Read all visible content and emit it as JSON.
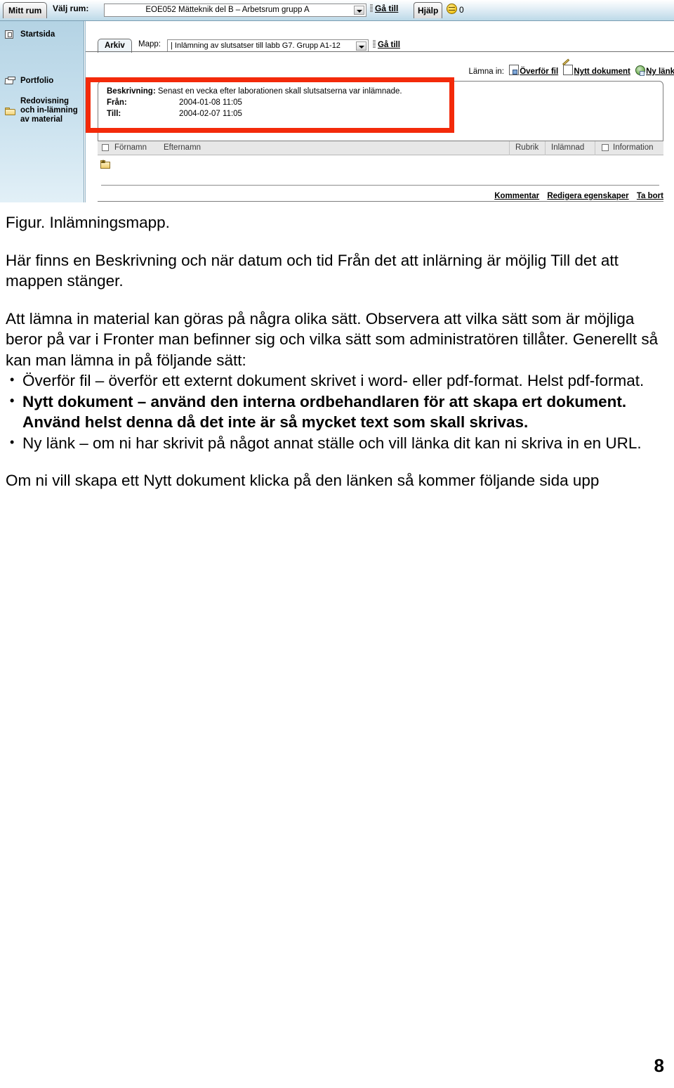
{
  "screenshot": {
    "topbar": {
      "mitt_rum_tab": "Mitt rum",
      "valj_rum_label": "Välj rum:",
      "room_selected": "EOE052 Mätteknik del B – Arbetsrum grupp A",
      "go_to_label": "Gå till",
      "help_tab": "Hjälp",
      "face_count": "0",
      "face_icon": "smiley-face-icon"
    },
    "sidebar": {
      "items": [
        {
          "label": "Startsida",
          "icon": "home-screen-icon"
        },
        {
          "label": "Portfolio",
          "icon": "open-folder-icon"
        },
        {
          "label": "Redovisning och in-lämning av material",
          "icon": "closed-folder-icon"
        }
      ]
    },
    "content": {
      "arkiv_tab": "Arkiv",
      "mapp_label": "Mapp:",
      "folder_selected": "|  Inlämning av slutsatser till labb G7. Grupp A1-12",
      "go_to_label": "Gå till",
      "submit_row": {
        "label": "Lämna in:",
        "links": [
          {
            "text": "Överför fil",
            "icon": "upload-file-icon"
          },
          {
            "text": "Nytt dokument",
            "icon": "new-document-pencil-icon"
          },
          {
            "text": "Ny länk",
            "icon": "new-link-globe-icon"
          }
        ]
      },
      "info": {
        "beskrivning_key": "Beskrivning:",
        "beskrivning_value": "Senast en vecka efter laborationen skall slutsatserna var inlämnade.",
        "fran_key": "Från:",
        "fran_value": "2004-01-08 11:05",
        "till_key": "Till:",
        "till_value": "2004-02-07 11:05"
      },
      "table": {
        "headers": [
          "Förnamn",
          "Efternamn",
          "Rubrik",
          "Inlämnad",
          "Information"
        ],
        "up_folder_icon": "up-one-level-folder-icon",
        "rows": []
      },
      "footer_links": [
        "Kommentar",
        "Redigera egenskaper",
        "Ta bort"
      ]
    },
    "highlight_color": "#f32a0a"
  },
  "document": {
    "figure_caption": "Figur. Inlämningsmapp.",
    "para1": "Här finns en Beskrivning och när datum och tid Från det att inlärning är möjlig Till det att mappen stänger.",
    "para2": "Att lämna in material kan göras på några olika sätt. Observera att vilka sätt som är möjliga beror på var i Fronter man befinner sig och vilka sätt som administratören tillåter. Generellt så kan man lämna in på följande sätt:",
    "bullets": [
      {
        "text": "Överför fil – överför ett externt dokument skrivet i word- eller pdf-format. Helst pdf-format.",
        "bold": false
      },
      {
        "text": "Nytt dokument – använd den interna ordbehandlaren för att skapa ert dokument. Använd helst denna då det inte är så mycket text som skall skrivas.",
        "bold": true
      },
      {
        "text": "Ny länk – om ni har skrivit på något annat ställe och vill länka dit kan ni skriva in en URL.",
        "bold": false
      }
    ],
    "para3": "Om ni vill skapa ett Nytt dokument klicka på den länken så kommer följande sida upp",
    "page_number": "8"
  }
}
